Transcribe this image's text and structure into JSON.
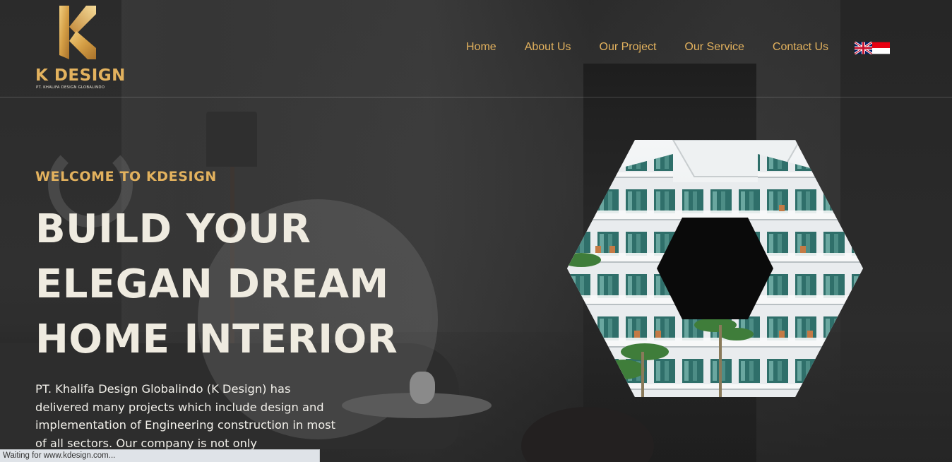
{
  "brand": {
    "name": "K DESIGN",
    "tagline": "PT. KHALIFA DESIGN GLOBALINDO",
    "logo_letter": "K",
    "color_gold": "#e3b25e",
    "color_cream": "#efebe0"
  },
  "nav": {
    "items": [
      {
        "label": "Home"
      },
      {
        "label": "About Us"
      },
      {
        "label": "Our Project"
      },
      {
        "label": "Our Service"
      },
      {
        "label": "Contact Us"
      }
    ],
    "languages": [
      {
        "icon": "uk-flag-icon"
      },
      {
        "icon": "indonesia-flag-icon"
      }
    ]
  },
  "hero": {
    "kicker": "WELCOME TO KDESIGN",
    "title_lines": [
      "BUILD YOUR",
      "ELEGAN DREAM",
      "HOME INTERIOR"
    ],
    "description": "PT. Khalifa Design Globalindo (K Design) has delivered many projects which include design and implementation of Engineering construction in most of all sectors. Our company is not only"
  },
  "status": {
    "text": "Waiting for www.kdesign.com..."
  }
}
